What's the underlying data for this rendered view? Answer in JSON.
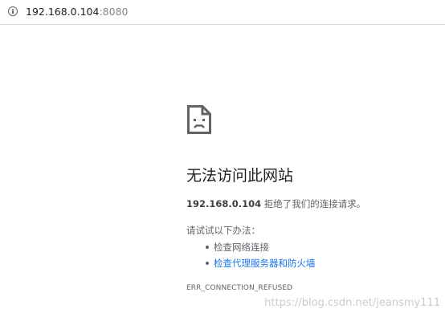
{
  "address_bar": {
    "icon": "info-icon",
    "url_host": "192.168.0.104",
    "url_port": ":8080"
  },
  "error": {
    "icon": "sad-document-icon",
    "title": "无法访问此网站",
    "host": "192.168.0.104",
    "message": " 拒绝了我们的连接请求。",
    "try_heading": "请试试以下办法：",
    "suggestions": [
      {
        "label": "检查网络连接",
        "is_link": false
      },
      {
        "label": "检查代理服务器和防火墙",
        "is_link": true
      }
    ],
    "error_code": "ERR_CONNECTION_REFUSED"
  },
  "watermark": "https://blog.csdn.net/jeansmy111",
  "colors": {
    "text": "#202124",
    "secondary": "#5f6368",
    "link": "#1a73e8",
    "border": "#dadce0"
  }
}
